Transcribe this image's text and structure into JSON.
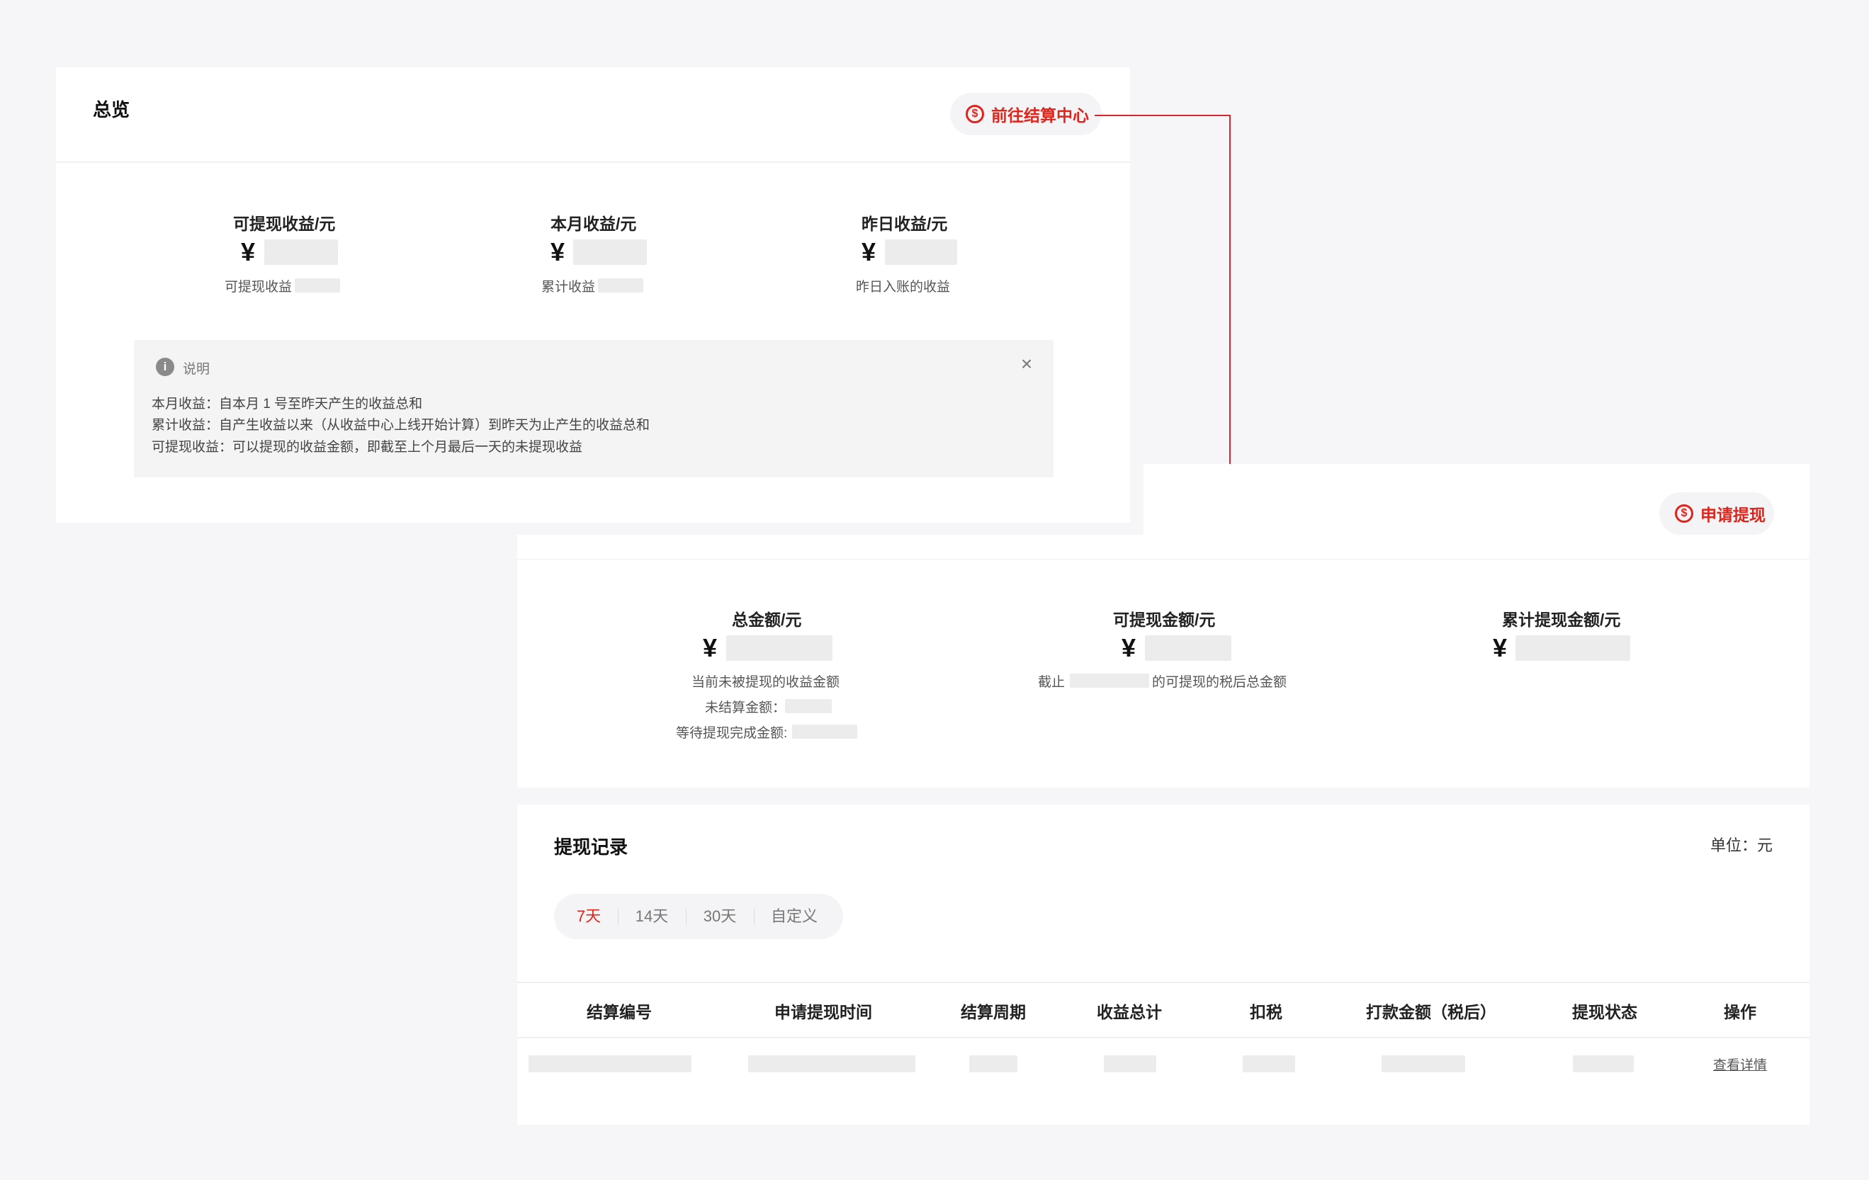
{
  "overview": {
    "title": "总览",
    "settlement_button": "前往结算中心",
    "settlement_icon": "dollar-circle-icon",
    "stats": [
      {
        "label": "可提现收益/元",
        "currency": "¥",
        "sub": "可提现收益"
      },
      {
        "label": "本月收益/元",
        "currency": "¥",
        "sub": "累计收益"
      },
      {
        "label": "昨日收益/元",
        "currency": "¥",
        "sub": "昨日入账的收益"
      }
    ],
    "notice": {
      "title": "说明",
      "lines": [
        "本月收益：自本月 1 号至昨天产生的收益总和",
        "累计收益：自产生收益以来（从收益中心上线开始计算）到昨天为止产生的收益总和",
        "可提现收益：可以提现的收益金额，即截至上个月最后一天的未提现收益"
      ]
    }
  },
  "withdraw": {
    "apply_button": "申请提现",
    "apply_icon": "dollar-circle-icon",
    "stats": [
      {
        "label": "总金额/元",
        "currency": "¥",
        "sub1": "当前未被提现的收益金额",
        "sub2": "未结算金额：",
        "sub3": "等待提现完成金额:"
      },
      {
        "label": "可提现金额/元",
        "currency": "¥",
        "sub_prefix": "截止",
        "sub_suffix": "的可提现的税后总金额"
      },
      {
        "label": "累计提现金额/元",
        "currency": "¥"
      }
    ]
  },
  "records": {
    "title": "提现记录",
    "unit": "单位：元",
    "range_tabs": [
      "7天",
      "14天",
      "30天",
      "自定义"
    ],
    "active_tab": "7天",
    "columns": [
      "结算编号",
      "申请提现时间",
      "结算周期",
      "收益总计",
      "扣税",
      "打款金额（税后）",
      "提现状态",
      "操作"
    ],
    "row_action": "查看详情"
  },
  "colors": {
    "accent": "#e2231a",
    "background": "#f6f6f8",
    "placeholder": "#ececec"
  }
}
